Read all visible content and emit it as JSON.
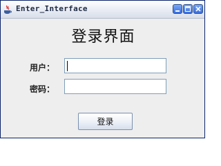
{
  "window": {
    "title": "Enter_Interface"
  },
  "main": {
    "heading": "登录界面",
    "user_label": "用户：",
    "user_value": "",
    "password_label": "密码：",
    "password_value": "",
    "login_label": "登录"
  },
  "icons": [
    "java-cup-icon",
    "minimize-icon",
    "maximize-icon",
    "close-icon"
  ]
}
